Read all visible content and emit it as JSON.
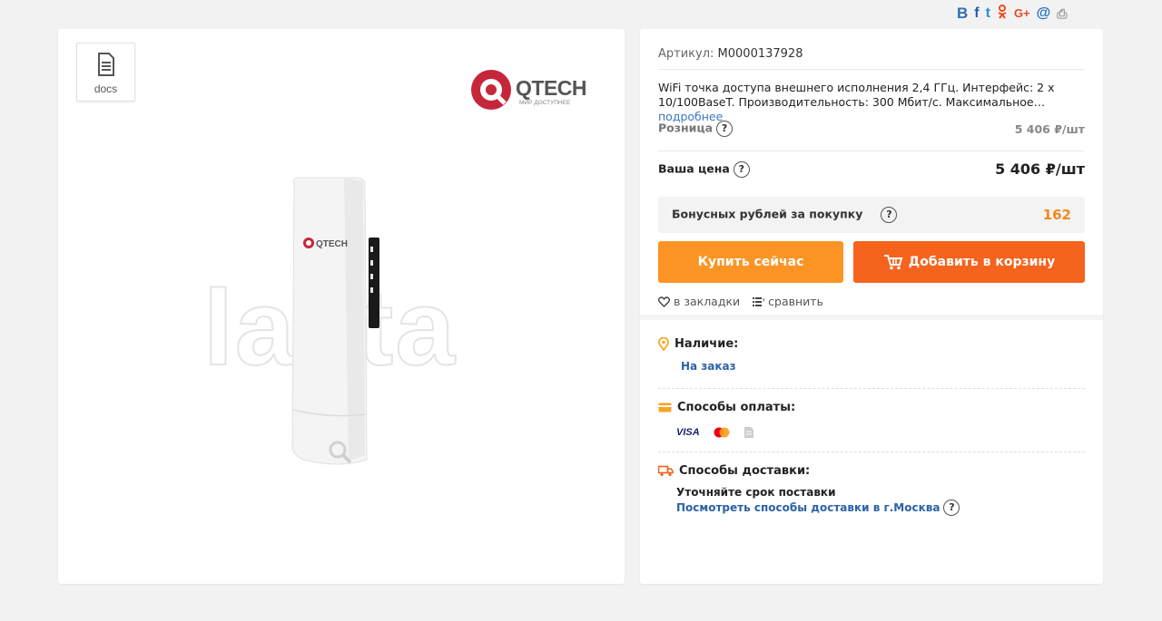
{
  "share": {
    "vk": "В",
    "fb": "f",
    "tw": "t",
    "ok": "ok",
    "gp": "G+",
    "mail": "@",
    "print": "⎙"
  },
  "left": {
    "docs_label": "docs",
    "brand": "QTECH",
    "brand_sub": "МИР ДОСТУПНЕЕ",
    "watermark": "lasta"
  },
  "product": {
    "article_label": "Артикул:",
    "article_value": "M0000137928",
    "description": "WiFi точка доступа внешнего исполнения 2,4 ГГц. Интерфейс: 2 x 10/100BaseT. Производительность: 300 Мбит/с. Максимальное…",
    "more_link": "подробнее",
    "retail_label": "Розница",
    "retail_price": "5 406 ₽/шт",
    "your_price_label": "Ваша цена",
    "your_price": "5 406 ₽/шт",
    "bonus_label": "Бонусных рублей за покупку",
    "bonus_value": "162",
    "buy_now": "Купить сейчас",
    "add_to_cart": "Добавить в корзину",
    "bookmarks": "в закладки",
    "compare": "сравнить",
    "qmark": "?"
  },
  "availability": {
    "title": "Наличие:",
    "value": "На заказ"
  },
  "payment": {
    "title": "Способы оплаты:",
    "visa": "VISA"
  },
  "delivery": {
    "title": "Способы доставки:",
    "note": "Уточняйте срок поставки",
    "link": "Посмотреть способы доставки в г.Москва"
  },
  "colors": {
    "orange": "#fb9425",
    "orange_dark": "#f5631d",
    "link": "#2d62a6"
  }
}
